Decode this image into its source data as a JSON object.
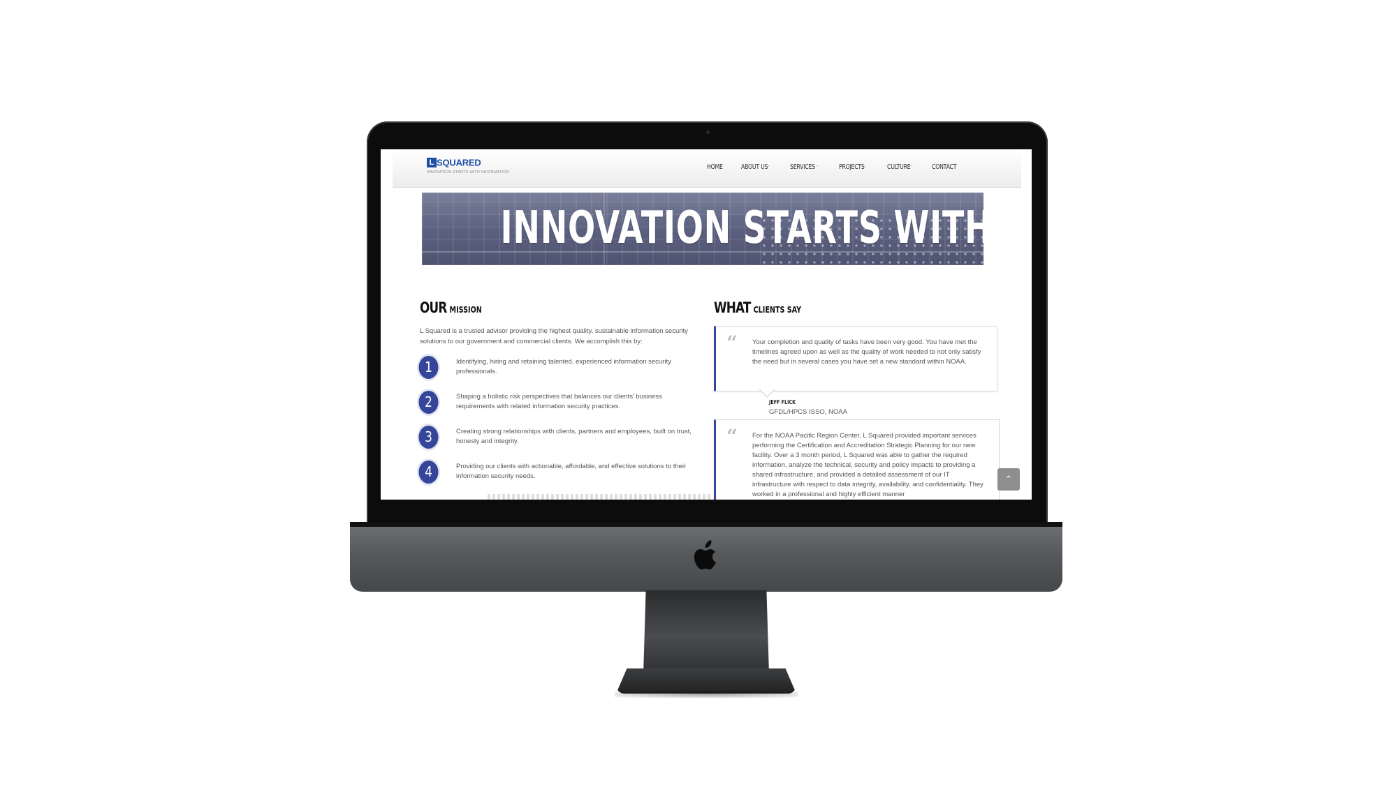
{
  "site": {
    "logo": {
      "mark": "L",
      "word": "SQUARED",
      "tagline": "INNOVATION STARTS WITH INFORMATION"
    },
    "nav": [
      {
        "label": "HOME",
        "dropdown": false
      },
      {
        "label": "ABOUT US",
        "dropdown": true
      },
      {
        "label": "SERVICES",
        "dropdown": true
      },
      {
        "label": "PROJECTS",
        "dropdown": true
      },
      {
        "label": "CULTURE",
        "dropdown": true
      },
      {
        "label": "CONTACT",
        "dropdown": false
      }
    ],
    "banner": {
      "text": "INNOVATION STARTS WITH INFORMATION"
    },
    "mission": {
      "title_big": "OUR",
      "title_small": "MISSION",
      "intro": "L Squared is a trusted advisor providing the highest quality, sustainable information security solutions to our government and commercial clients. We accomplish this by:",
      "steps": [
        {
          "num": "1",
          "text": "Identifying, hiring and retaining talented, experienced information security professionals."
        },
        {
          "num": "2",
          "text": "Shaping a holistic risk perspectives that balances our clients' business requirements with related information security practices."
        },
        {
          "num": "3",
          "text": "Creating strong relationships with clients, partners and employees, built on trust, honesty and integrity."
        },
        {
          "num": "4",
          "text": "Providing our clients with actionable, affordable, and effective solutions to their information security needs."
        }
      ]
    },
    "clients": {
      "title_big": "WHAT",
      "title_small": "CLIENTS SAY",
      "testimonials": [
        {
          "text": "Your completion and quality of tasks have been very good. You have met the timelines agreed upon as well as the quality of work needed to not only satisfy the need but in several cases you have set a new standard within NOAA.",
          "author": "JEFF FLICK",
          "role": "GFDL/HPCS ISSO, NOAA"
        },
        {
          "text": "For the NOAA Pacific Region Center, L Squared provided important services performing the Certification and Accreditation Strategic Planning for our new facility. Over a 3 month period, L Squared was able to gather the required information, analyze the technical, security and policy impacts to providing a shared infrastructure, and provided a detailed assessment of our IT infrastructure with respect to data integrity, availability, and confidentiality. They worked in a professional and highly efficient manner"
        }
      ]
    },
    "quote_glyph": "“",
    "scroll_top_icon": "⌃"
  },
  "colors": {
    "brand": "#1f4fa3",
    "accent": "#34459a",
    "text": "#555555"
  }
}
